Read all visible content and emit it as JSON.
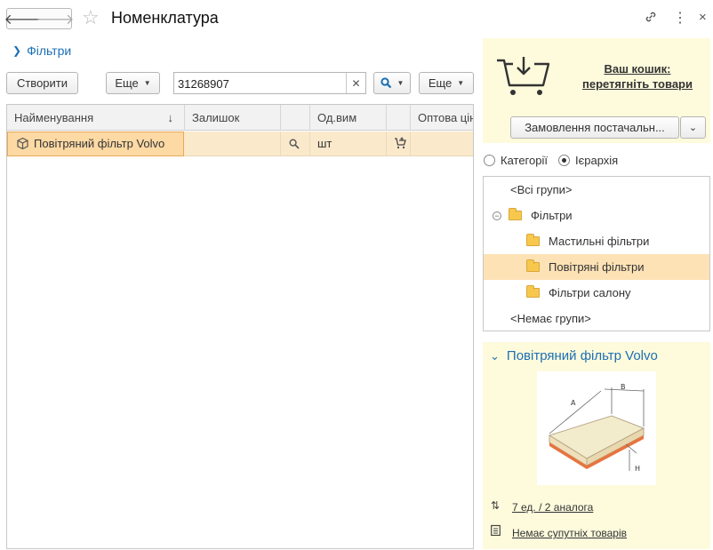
{
  "window": {
    "title": "Номенклатура",
    "icons": [
      "arrow-left-icon",
      "arrow-right-icon",
      "star-icon",
      "link-icon",
      "more-icon",
      "close-icon"
    ]
  },
  "filters": {
    "label": "Фільтри"
  },
  "toolbar": {
    "create_label": "Створити",
    "more_label": "Еще",
    "search_value": "31268907",
    "more2_label": "Еще"
  },
  "table": {
    "columns": [
      "Найменування",
      "Залишок",
      "",
      "Од.вим",
      "",
      "Оптова ціна"
    ],
    "sort_indicator": "↓",
    "rows": [
      {
        "name": "Повітряний фільтр Volvo",
        "stock": "",
        "unit": "шт",
        "price": ""
      }
    ]
  },
  "cart": {
    "link_line1": "Ваш кошик:",
    "link_line2": "перетягніть товари",
    "order_button": "Замовлення постачальн..."
  },
  "view_mode": {
    "options": [
      "Категорії",
      "Ієрархія"
    ],
    "selected": "Ієрархія"
  },
  "tree": {
    "items": [
      {
        "label": "<Всі групи>",
        "level": 0,
        "folder": false
      },
      {
        "label": "Фільтри",
        "level": 1,
        "folder": true,
        "expanded": true
      },
      {
        "label": "Мастильні фільтри",
        "level": 2,
        "folder": true
      },
      {
        "label": "Повітряні фільтри",
        "level": 2,
        "folder": true,
        "selected": true
      },
      {
        "label": "Фільтри салону",
        "level": 2,
        "folder": true
      },
      {
        "label": "<Немає групи>",
        "level": 0,
        "folder": false
      }
    ]
  },
  "details": {
    "title": "Повітряний фільтр Volvo",
    "image_labels": {
      "a": "A",
      "b": "B",
      "h": "H"
    },
    "analogs_link": "7 ед. / 2 аналога",
    "related_link": "Немає супутніх товарів"
  },
  "colors": {
    "accent_blue": "#1c6fb4",
    "selection": "#fbe9cc",
    "panel_yellow": "#fdfbdc"
  }
}
